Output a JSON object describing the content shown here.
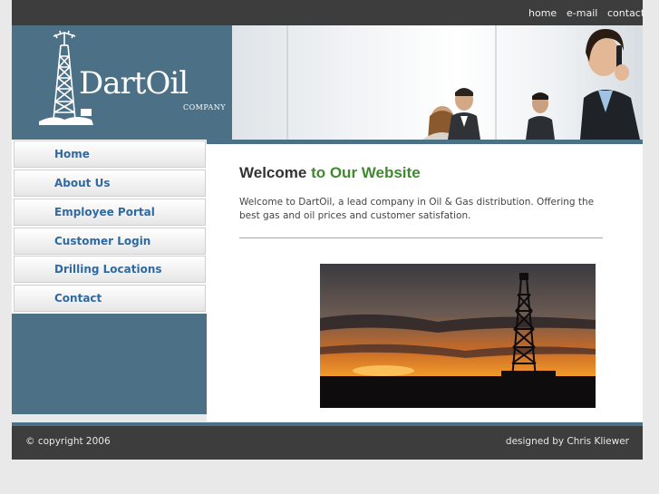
{
  "topnav": {
    "home": "home",
    "email": "e-mail",
    "contact": "contact"
  },
  "banner": {
    "logo_text": "DartOil",
    "logo_sub": "COMPANY"
  },
  "sidebar": {
    "items": [
      {
        "label": "Home"
      },
      {
        "label": "About Us"
      },
      {
        "label": "Employee Portal"
      },
      {
        "label": "Customer Login"
      },
      {
        "label": "Drilling Locations"
      },
      {
        "label": "Contact"
      }
    ]
  },
  "main": {
    "title_part1": "Welcome",
    "title_part2": "to Our Website",
    "intro": "Welcome to DartOil, a lead company in Oil & Gas distribution. Offering the best gas and oil prices and customer satisfation."
  },
  "footer": {
    "copyright": "© copyright 2006",
    "credit": "designed by Chris Kliewer"
  },
  "colors": {
    "accent_blue": "#4c7086",
    "link_blue": "#2f6aa3",
    "title_green": "#3f8a2e",
    "dark_bar": "#3d3d3d"
  },
  "icons": {
    "logo": "oil-derrick-icon",
    "photo": "oil-rig-sunset-image"
  }
}
